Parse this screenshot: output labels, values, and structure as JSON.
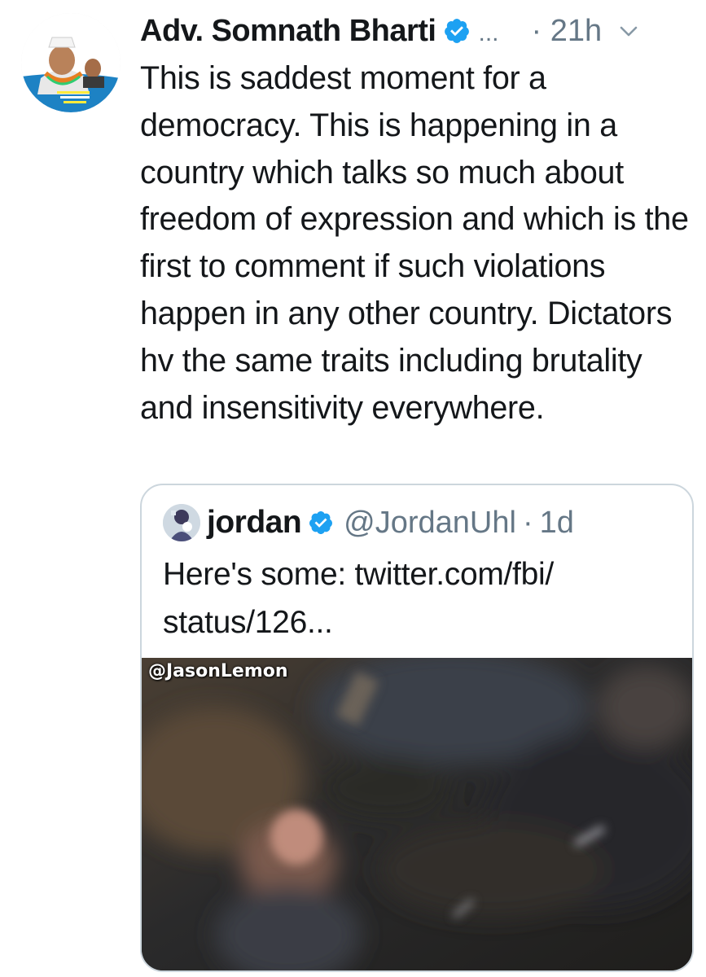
{
  "tweet": {
    "display_name": "Adv. Somnath Bharti",
    "ellipsis": "...",
    "time": "· 21h",
    "text": "This is saddest moment for a democracy. This is happening in a country which talks so much about freedom of expression and which is the first to comment if such violations happen in any other country. Dictators hv the same traits including brutality and insensitivity everywhere.",
    "avatar_icon": "profile-avatar",
    "verified_icon": "verified-badge-icon",
    "menu_icon": "chevron-down-icon"
  },
  "quoted_tweet": {
    "display_name": "jordan",
    "handle": "@JordanUhl",
    "dot": "·",
    "time": "1d",
    "text": "Here's some: twitter.com/fbi/status/126...",
    "text_line1": "Here's some: twitter.com/fbi/",
    "text_line2": "status/126...",
    "media": {
      "watermark": "@JasonLemon"
    }
  },
  "colors": {
    "text": "#14171a",
    "secondary": "#657786",
    "verified_blue": "#1da1f2",
    "border": "#ccd6dd"
  }
}
